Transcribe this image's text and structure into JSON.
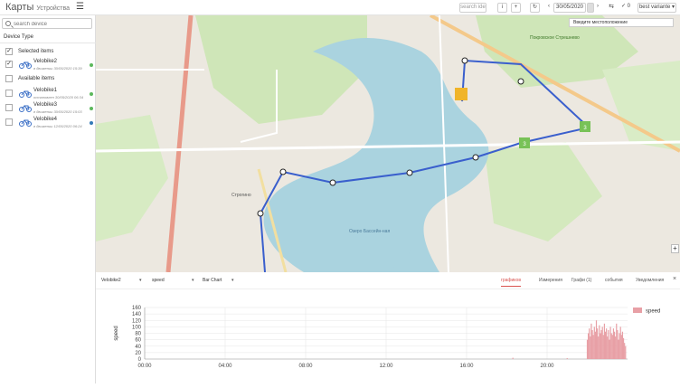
{
  "app": {
    "title": "Карты",
    "subtitle": "Устройства"
  },
  "toolbar": {
    "search_placeholder": "search ide",
    "info_label": "i",
    "add_label": "+",
    "refresh_label": "↻",
    "date": "30/05/2020",
    "prev_label": "‹",
    "next_label": "›",
    "check_label": "✓ 0",
    "layer_select": "best variante ▾"
  },
  "sidebar": {
    "search_placeholder": "search device",
    "device_type_label": "Device Type",
    "selected_items_label": "Selected items",
    "available_items_label": "Available items",
    "selected_devices": [
      {
        "name": "Velobike2",
        "sub": "в движении 30/05/2020 15:39",
        "status_color": "#5cb85c"
      }
    ],
    "available_devices": [
      {
        "name": "Velobike1",
        "sub": "остановлен 30/05/2020 06:34",
        "status_color": "#5cb85c"
      },
      {
        "name": "Velobike3",
        "sub": "в движении 30/05/2020 15:03",
        "status_color": "#5cb85c"
      },
      {
        "name": "Velobike4",
        "sub": "в движении 12/05/2020 06:24",
        "status_color": "#337ab7"
      }
    ]
  },
  "map": {
    "popup_text": "Введите местоположение",
    "zoom_in_label": "+",
    "labels": {
      "river": "Озеро Бассейн-ная",
      "district": "Строгино",
      "park": "Покровское Стрешнево"
    },
    "cluster_labels": [
      "3",
      "3"
    ]
  },
  "chart_toolbar": {
    "device_select": "Velobike2",
    "param_select": "speed",
    "chart_type_select": "Bar Chart",
    "tabs": [
      {
        "label": "графиков",
        "active": true
      },
      {
        "label": "Измерения",
        "active": false
      },
      {
        "label": "Графи (1)",
        "active": false
      },
      {
        "label": "события",
        "active": false
      },
      {
        "label": "Уведомления",
        "active": false
      }
    ],
    "close_label": "×"
  },
  "chart_data": {
    "type": "bar",
    "ylabel": "speed",
    "xlabel": "",
    "ylim": [
      0,
      160
    ],
    "yticks": [
      0,
      20,
      40,
      60,
      80,
      100,
      120,
      140,
      160
    ],
    "xticks": [
      "00:00",
      "04:00",
      "08:00",
      "12:00",
      "16:00",
      "20:00"
    ],
    "x_range_hours": [
      0,
      24
    ],
    "legend": [
      {
        "name": "speed",
        "color": "#e8a0a6",
        "position": "top-right"
      }
    ],
    "series": [
      {
        "name": "speed",
        "color": "#e8a0a6",
        "x_hours": [
          18.3,
          21.0,
          22.0,
          22.05,
          22.1,
          22.15,
          22.2,
          22.25,
          22.3,
          22.35,
          22.4,
          22.45,
          22.5,
          22.55,
          22.6,
          22.65,
          22.7,
          22.75,
          22.8,
          22.85,
          22.9,
          22.95,
          23.0,
          23.05,
          23.1,
          23.15,
          23.2,
          23.25,
          23.3,
          23.35,
          23.4,
          23.45,
          23.5,
          23.55,
          23.6,
          23.65,
          23.7,
          23.75,
          23.8,
          23.85,
          23.9
        ],
        "values": [
          4,
          3,
          60,
          80,
          95,
          70,
          110,
          90,
          75,
          100,
          85,
          120,
          95,
          70,
          105,
          80,
          90,
          100,
          75,
          110,
          85,
          95,
          70,
          90,
          60,
          100,
          80,
          75,
          95,
          85,
          70,
          110,
          90,
          60,
          80,
          100,
          75,
          85,
          65,
          50,
          40
        ]
      }
    ]
  }
}
